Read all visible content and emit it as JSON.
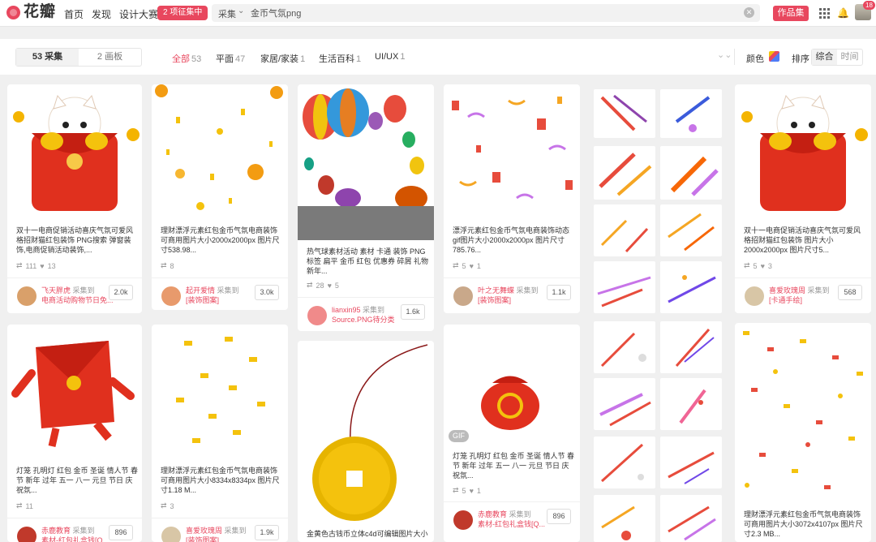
{
  "topbar": {
    "logo_text": "花瓣",
    "nav": [
      "首页",
      "发现",
      "设计大赛"
    ],
    "promo_badge": "2 项征集中",
    "search_category": "采集",
    "search_value": "金币气氛png",
    "works_button": "作品集",
    "notification_count": "18",
    "brand_color": "#e8475e"
  },
  "filters": {
    "segments": [
      {
        "label": "53 采集"
      },
      {
        "label": "2 画板"
      }
    ],
    "tabs": [
      {
        "label": "全部",
        "count": "53"
      },
      {
        "label": "平面",
        "count": "47"
      },
      {
        "label": "家居/家装",
        "count": "1"
      },
      {
        "label": "生活百科",
        "count": "1"
      },
      {
        "label": "UI/UX",
        "count": "1"
      }
    ],
    "color_label": "颜色",
    "sort_label": "排序",
    "sort_options": [
      "综合",
      "时间"
    ]
  },
  "cards": [
    {
      "title": "双十一电商促销活动喜庆气氛可爱风格招财猫红包装饰 PNG搜索 弹窗装饰,电商促销活动装饰,...",
      "repins": "111",
      "likes": "13",
      "user": "飞天胖虎",
      "action": "采集到",
      "board": "电商活动购物节日免...",
      "count": "2.0k"
    },
    {
      "title": "理财漂浮元素红包金币气氛电商装饰可商用图片大小2000x2000px 图片尺寸538.98...",
      "repins": "8",
      "likes": "",
      "user": "起开爱情",
      "action": "采集到",
      "board": "[装饰图案]",
      "count": "3.0k"
    },
    {
      "title": "热气球素材活动 素材 卡通 装饰 PNG 标签 扁平 金币 红包 优惠券 碎屑 礼物 新年...",
      "repins": "28",
      "likes": "5",
      "user": "lianxin95",
      "action": "采集到",
      "board": "Source.PNG待分类",
      "count": "1.6k"
    },
    {
      "title": "漂浮元素红包金币气氛电商装饰动态gif图片大小2000x2000px 图片尺寸785.76...",
      "repins": "5",
      "likes": "1",
      "user": "叶之无舞蝶",
      "action": "采集到",
      "board": "[装饰图案]",
      "count": "1.1k"
    },
    {
      "title": "双十一电商促销活动喜庆气氛可爱风格招财猫红包装饰 图片大小2000x2000px 图片尺寸5...",
      "repins": "5",
      "likes": "3",
      "user": "喜爱玫瑰周",
      "action": "采集到",
      "board": "[卡通手绘]",
      "count": "568"
    },
    {
      "title": "灯笼 孔明灯 红包 金币 圣诞 情人节 春节 新年 过年 五一 八一 元旦 节日 庆祝氛...",
      "repins": "11",
      "likes": "",
      "user": "赤鹿教育",
      "action": "采集到",
      "board": "素材-红包礼盒钱[Q...",
      "count": "896"
    },
    {
      "title": "理财漂浮元素红包金币气氛电商装饰可商用图片大小8334x8334px 图片尺寸1.18 M...",
      "repins": "3",
      "likes": "",
      "user": "喜爱玫瑰周",
      "action": "采集到",
      "board": "[装饰图案]",
      "count": "1.9k"
    },
    {
      "title": "金黄色古钱币立体c4d可编辑图片大小",
      "repins": "",
      "likes": "",
      "user": "",
      "action": "",
      "board": "",
      "count": ""
    },
    {
      "title": "灯笼 孔明灯 红包 金币 圣诞 情人节 春节 新年 过年 五一 八一 元旦 节日 庆祝氛...",
      "repins": "5",
      "likes": "1",
      "user": "赤鹿教育",
      "action": "采集到",
      "board": "素材-红包礼盒钱[Q...",
      "count": "896",
      "gif_tag": "GIF"
    },
    {
      "title": "理财漂浮元素红包金币气氛电商装饰可商用图片大小3072x4107px 图片尺寸2.3 MB...",
      "repins": "",
      "likes": "",
      "user": "",
      "action": "",
      "board": "",
      "count": ""
    }
  ]
}
